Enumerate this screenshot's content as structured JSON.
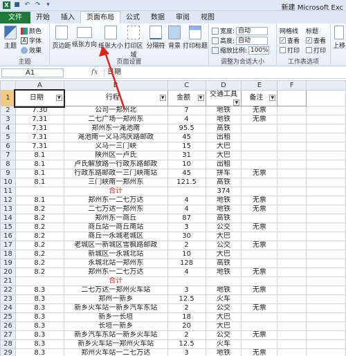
{
  "titlebar": {
    "app_title": "新建 Microsoft Exc",
    "quick_access": [
      "save-icon",
      "undo-icon",
      "redo-icon",
      "customize-icon"
    ]
  },
  "tabs": [
    "文件",
    "开始",
    "插入",
    "页面布局",
    "公式",
    "数据",
    "审阅",
    "视图"
  ],
  "active_tab": "页面布局",
  "ribbon": {
    "themes": {
      "label": "主题",
      "colors": "颜色",
      "fonts": "字体",
      "effects": "效果",
      "group": "主题"
    },
    "page_setup": {
      "margins": "页边距",
      "orientation": "纸张方向",
      "size": "纸张大小",
      "print_area": "打印区域",
      "breaks": "分隔符",
      "background": "背景",
      "print_titles": "打印标题",
      "group": "页面设置"
    },
    "scale": {
      "width_label": "宽度:",
      "width_value": "自动",
      "height_label": "高度:",
      "height_value": "自动",
      "scale_label": "缩放比例:",
      "scale_value": "100%",
      "group": "调整为合适大小"
    },
    "sheet_options": {
      "gridlines": "网格线",
      "headings": "标题",
      "view": "查看",
      "print": "打印",
      "group": "工作表选项"
    },
    "arrange": {
      "bring_forward": "上移"
    }
  },
  "formula_bar": {
    "name_box": "A1",
    "fx": "fx",
    "formula": "日期"
  },
  "columns": [
    "A",
    "B",
    "C",
    "D",
    "E",
    "F"
  ],
  "header": [
    "日期",
    "行程",
    "金额",
    "交通工具",
    "备注",
    ""
  ],
  "rows": [
    {
      "n": "1",
      "cells": [
        "日期",
        "行程",
        "金额",
        "交通工具",
        "备注",
        ""
      ]
    },
    {
      "n": "2",
      "cells": [
        "7.30",
        "公司一郑州北",
        "7",
        "地铁",
        "无票",
        ""
      ]
    },
    {
      "n": "3",
      "cells": [
        "7.31",
        "二七广场一郑州东",
        "4",
        "地铁",
        "无票",
        ""
      ]
    },
    {
      "n": "4",
      "cells": [
        "7.31",
        "郑州东一渑池南",
        "95.5",
        "高铁",
        "",
        ""
      ]
    },
    {
      "n": "5",
      "cells": [
        "7.31",
        "渑池南一义马鸿庆路邮政",
        "45",
        "出租",
        "",
        ""
      ]
    },
    {
      "n": "6",
      "cells": [
        "7.31",
        "义马一三门峡",
        "15",
        "大巴",
        "",
        ""
      ]
    },
    {
      "n": "7",
      "cells": [
        "8.1",
        "陕州区一卢氏",
        "31",
        "大巴",
        "",
        ""
      ]
    },
    {
      "n": "8",
      "cells": [
        "8.1",
        "卢氏解放路一行政东路邮政",
        "10",
        "出租",
        "",
        ""
      ]
    },
    {
      "n": "9",
      "cells": [
        "8.1",
        "行政东路邮政一三门峡南站",
        "45",
        "拼车",
        "无票",
        ""
      ]
    },
    {
      "n": "10",
      "cells": [
        "8.1",
        "三门峡南一郑州东",
        "121.5",
        "高铁",
        "",
        ""
      ]
    },
    {
      "n": "11",
      "cells": [
        "",
        "合计",
        "",
        "374",
        "",
        ""
      ],
      "total": true
    },
    {
      "n": "12",
      "cells": [
        "8.1",
        "郑州东一二七万达",
        "4",
        "地铁",
        "无票",
        ""
      ]
    },
    {
      "n": "13",
      "cells": [
        "8.2",
        "二七万达一郑州东",
        "4",
        "地铁",
        "无票",
        ""
      ]
    },
    {
      "n": "14",
      "cells": [
        "8.2",
        "郑州东一商丘",
        "87",
        "高铁",
        "",
        ""
      ]
    },
    {
      "n": "15",
      "cells": [
        "8.2",
        "商丘站一商丘南站",
        "3",
        "公交",
        "无票",
        ""
      ]
    },
    {
      "n": "16",
      "cells": [
        "8.2",
        "商丘一永城老城区",
        "30",
        "大巴",
        "",
        ""
      ]
    },
    {
      "n": "17",
      "cells": [
        "8.2",
        "老城区一新城区雪枫路邮政",
        "2",
        "公交",
        "无票",
        ""
      ]
    },
    {
      "n": "18",
      "cells": [
        "8.2",
        "新城区一永城北站",
        "10",
        "大巴",
        "",
        ""
      ]
    },
    {
      "n": "19",
      "cells": [
        "8.2",
        "永城北站一郑州东",
        "128",
        "高铁",
        "",
        ""
      ]
    },
    {
      "n": "20",
      "cells": [
        "8.2",
        "郑州东一二七万达",
        "4",
        "地铁",
        "无票",
        ""
      ]
    },
    {
      "n": "21",
      "cells": [
        "",
        "合计",
        "",
        "",
        "",
        ""
      ],
      "total": true
    },
    {
      "n": "22",
      "cells": [
        "8.3",
        "二七万达一郑州火车站",
        "3",
        "地铁",
        "无票",
        ""
      ]
    },
    {
      "n": "23",
      "cells": [
        "8.3",
        "郑州一新乡",
        "12.5",
        "火车",
        "",
        ""
      ]
    },
    {
      "n": "24",
      "cells": [
        "8.3",
        "新乡火车站一新乡汽车东站",
        "2",
        "公交",
        "无票",
        ""
      ]
    },
    {
      "n": "25",
      "cells": [
        "8.3",
        "新乡一长垣",
        "18",
        "大巴",
        "",
        ""
      ]
    },
    {
      "n": "26",
      "cells": [
        "8.3",
        "长垣一新乡",
        "20",
        "大巴",
        "",
        ""
      ]
    },
    {
      "n": "27",
      "cells": [
        "8.3",
        "新乡汽车东站一新乡火车站",
        "2",
        "公交",
        "无票",
        ""
      ]
    },
    {
      "n": "28",
      "cells": [
        "8.3",
        "新乡火车站一郑州火车站",
        "12.5",
        "火车",
        "",
        ""
      ]
    },
    {
      "n": "29",
      "cells": [
        "8.3",
        "郑州火车站一二七万达",
        "3",
        "地铁",
        "无票",
        ""
      ]
    }
  ],
  "colors": {
    "file_tab": "#1d7a3a",
    "arrow": "#e0211a",
    "total_text": "#e0211a"
  }
}
